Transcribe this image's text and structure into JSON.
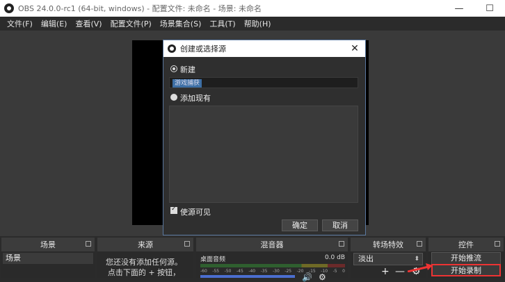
{
  "window": {
    "title": "OBS 24.0.0-rc1 (64-bit, windows) - 配置文件: 未命名 - 场景: 未命名",
    "minimize": "—",
    "maximize": "☐"
  },
  "menu": [
    "文件(F)",
    "编辑(E)",
    "查看(V)",
    "配置文件(P)",
    "场景集合(S)",
    "工具(T)",
    "帮助(H)"
  ],
  "docks": {
    "scenes": "场景",
    "sources": "来源",
    "mixer": "混音器",
    "transitions": "转场特效",
    "controls": "控件"
  },
  "scenes": {
    "items": [
      "场景"
    ]
  },
  "sources": {
    "hint_line1": "您还没有添加任何源。",
    "hint_line2": "点击下面的 + 按钮，"
  },
  "mixer": {
    "track_name": "桌面音频",
    "track_db": "0.0 dB",
    "ticks": [
      "-60",
      "-55",
      "-50",
      "-45",
      "-40",
      "-35",
      "-30",
      "-25",
      "-20",
      "-15",
      "-10",
      "-5",
      "0"
    ]
  },
  "transitions": {
    "selected": "淡出",
    "add": "+",
    "remove": "—"
  },
  "controls": {
    "start_streaming": "开始推流",
    "start_recording": "开始录制"
  },
  "dialog": {
    "title": "创建或选择源",
    "close": "✕",
    "new_label": "新建",
    "name_value": "游戏捕获",
    "add_existing_label": "添加现有",
    "visible_label": "使源可见",
    "ok": "确定",
    "cancel": "取消"
  },
  "colors": {
    "highlight": "#e33333",
    "accent": "#3d6fa5"
  },
  "icons": {
    "volume": "speaker-icon",
    "settings": "gear-icon"
  }
}
